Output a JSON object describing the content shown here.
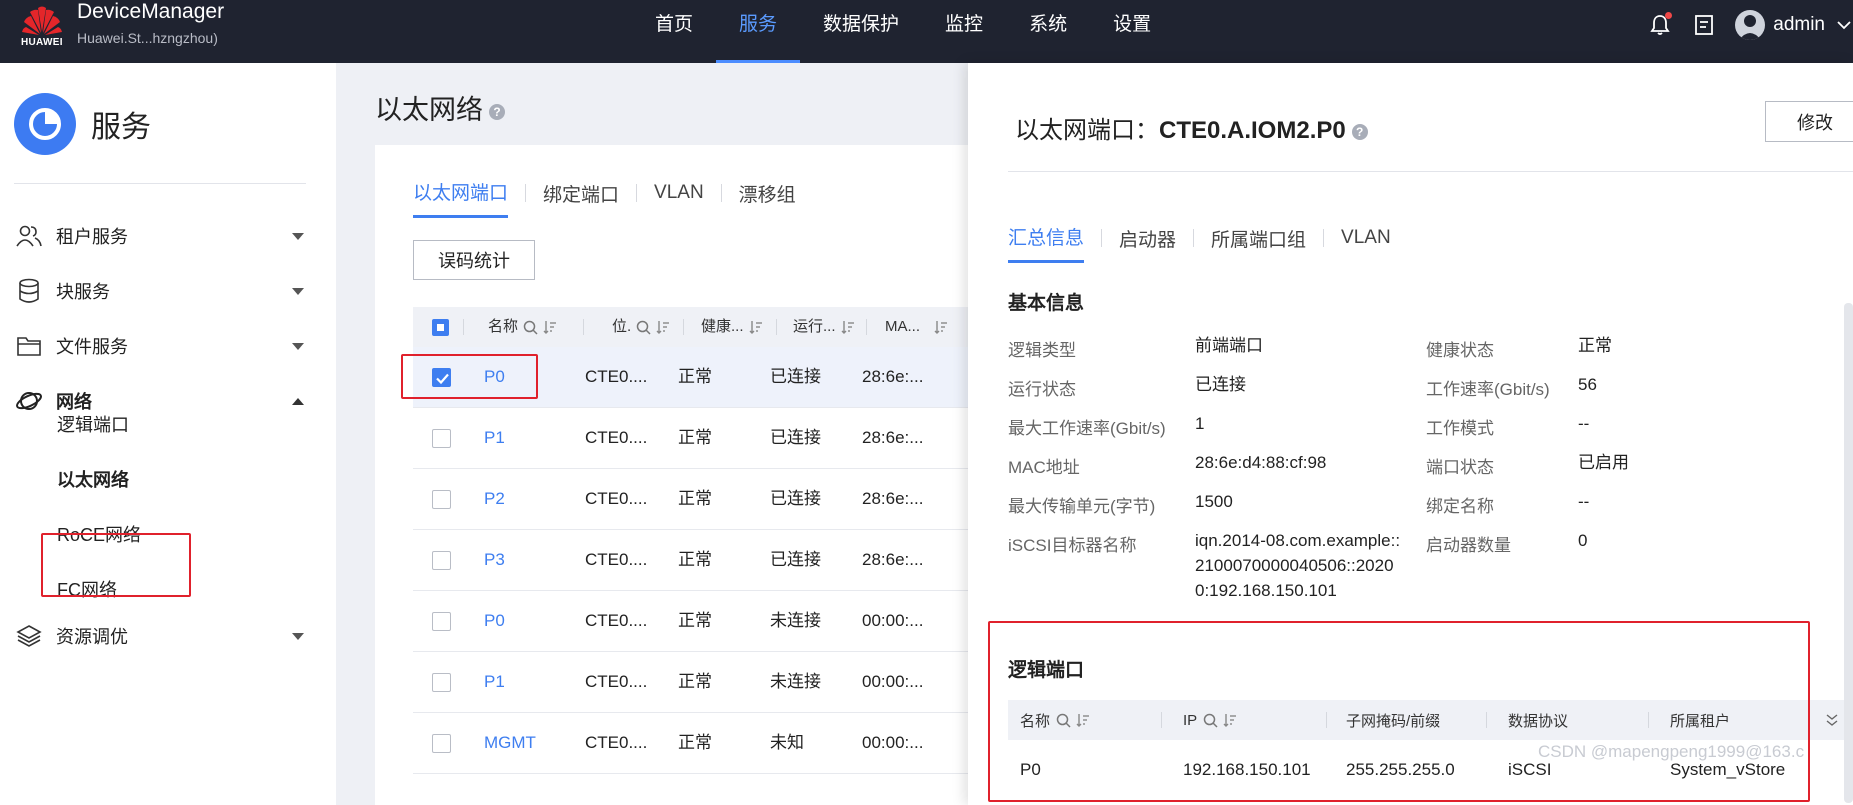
{
  "header": {
    "logo_text": "HUAWEI",
    "app_title": "DeviceManager",
    "device_name": "Huawei.St...hzngzhou)",
    "nav": [
      "首页",
      "服务",
      "数据保护",
      "监控",
      "系统",
      "设置"
    ],
    "active_nav": "服务",
    "user": "admin"
  },
  "sidebar": {
    "title": "服务",
    "items": [
      {
        "label": "租户服务",
        "icon": "user-group-icon",
        "expanded": false
      },
      {
        "label": "块服务",
        "icon": "database-icon",
        "expanded": false
      },
      {
        "label": "文件服务",
        "icon": "folder-icon",
        "expanded": false
      },
      {
        "label": "网络",
        "icon": "network-icon",
        "expanded": true
      },
      {
        "label": "资源调优",
        "icon": "layers-icon",
        "expanded": false
      }
    ],
    "network_sub": [
      "逻辑端口",
      "以太网络",
      "RoCE网络",
      "FC网络"
    ],
    "active_sub": "以太网络"
  },
  "main": {
    "title": "以太网络",
    "tabs": [
      "以太网端口",
      "绑定端口",
      "VLAN",
      "漂移组"
    ],
    "active_tab": "以太网端口",
    "error_stats_button": "误码统计",
    "columns": [
      "名称",
      "位.",
      "健康...",
      "运行...",
      "MA..."
    ],
    "rows": [
      {
        "name": "P0",
        "location": "CTE0....",
        "health": "正常",
        "running": "已连接",
        "mac": "28:6e:...",
        "checked": true
      },
      {
        "name": "P1",
        "location": "CTE0....",
        "health": "正常",
        "running": "已连接",
        "mac": "28:6e:...",
        "checked": false
      },
      {
        "name": "P2",
        "location": "CTE0....",
        "health": "正常",
        "running": "已连接",
        "mac": "28:6e:...",
        "checked": false
      },
      {
        "name": "P3",
        "location": "CTE0....",
        "health": "正常",
        "running": "已连接",
        "mac": "28:6e:...",
        "checked": false
      },
      {
        "name": "P0",
        "location": "CTE0....",
        "health": "正常",
        "running": "未连接",
        "mac": "00:00:...",
        "checked": false
      },
      {
        "name": "P1",
        "location": "CTE0....",
        "health": "正常",
        "running": "未连接",
        "mac": "00:00:...",
        "checked": false
      },
      {
        "name": "MGMT",
        "location": "CTE0....",
        "health": "正常",
        "running": "未知",
        "mac": "00:00:...",
        "checked": false
      }
    ]
  },
  "detail": {
    "title_prefix": "以太网端口：",
    "port_id": "CTE0.A.IOM2.P0",
    "edit_button": "修改",
    "tabs": [
      "汇总信息",
      "启动器",
      "所属端口组",
      "VLAN"
    ],
    "active_tab": "汇总信息",
    "basic_info_title": "基本信息",
    "left_fields": [
      {
        "label": "逻辑类型",
        "value": "前端端口"
      },
      {
        "label": "运行状态",
        "value": "已连接"
      },
      {
        "label": "最大工作速率(Gbit/s)",
        "value": "1"
      },
      {
        "label": "MAC地址",
        "value": "28:6e:d4:88:cf:98"
      },
      {
        "label": "最大传输单元(字节)",
        "value": "1500"
      },
      {
        "label": "iSCSI目标器名称",
        "value_lines": [
          "iqn.2014-08.com.example::",
          "2100070000040506::2020",
          "0:192.168.150.101"
        ]
      }
    ],
    "right_fields": [
      {
        "label": "健康状态",
        "value": "正常"
      },
      {
        "label": "工作速率(Gbit/s)",
        "value": "56"
      },
      {
        "label": "工作模式",
        "value": "--"
      },
      {
        "label": "端口状态",
        "value": "已启用"
      },
      {
        "label": "绑定名称",
        "value": "--"
      },
      {
        "label": "启动器数量",
        "value": "0"
      }
    ],
    "logical_ports_title": "逻辑端口",
    "lp_columns": [
      "名称",
      "IP",
      "子网掩码/前缀",
      "数据协议",
      "所属租户"
    ],
    "lp_rows": [
      {
        "name": "P0",
        "ip": "192.168.150.101",
        "mask": "255.255.255.0",
        "protocol": "iSCSI",
        "tenant": "System_vStore"
      }
    ]
  },
  "watermark": "CSDN @mapengpeng1999@163.c",
  "colors": {
    "accent": "#3e7ef0",
    "topbar": "#1f2330",
    "highlight_box": "#e0212c"
  }
}
